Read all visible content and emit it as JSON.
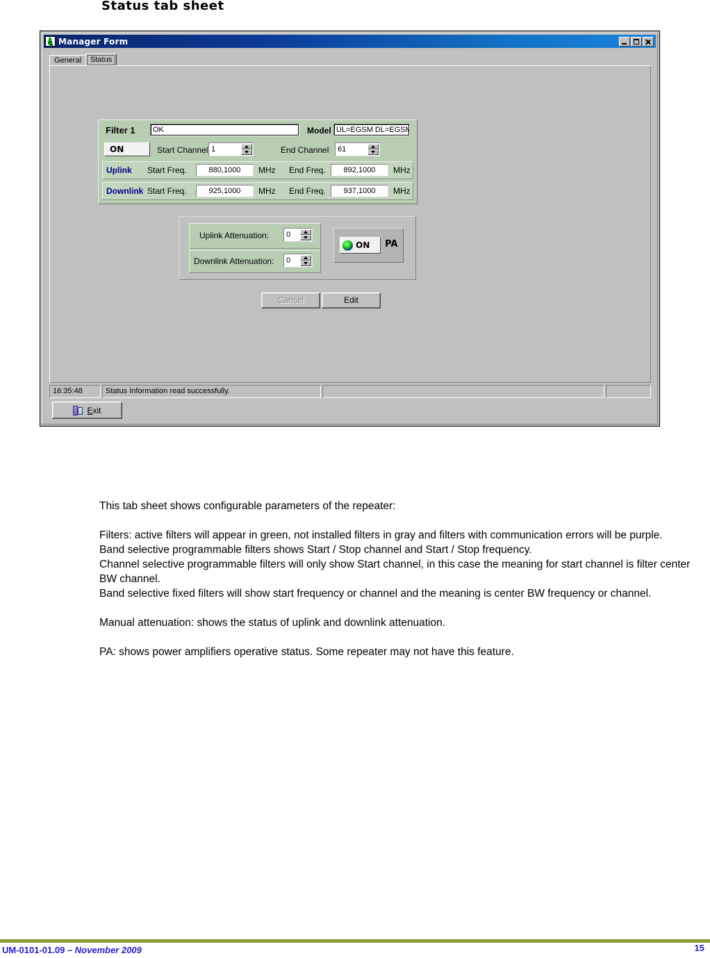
{
  "document": {
    "heading": "Status tab sheet",
    "paragraphs": [
      "This tab sheet shows configurable parameters of the repeater:",
      "Filters: active filters will appear in green, not installed filters in gray and filters with communication errors will be purple.",
      "Band selective programmable filters shows Start / Stop channel and Start / Stop frequency.",
      "Channel selective programmable filters will only show Start channel, in this case the meaning for start channel is filter center BW channel.",
      "Band selective fixed filters will show start frequency or channel and the meaning is center BW frequency or channel.",
      "Manual attenuation: shows the status of uplink and downlink attenuation.",
      "PA: shows power amplifiers operative status. Some repeater may not have this feature."
    ],
    "footer": {
      "doc_id": "UM-0101-01.09 – ",
      "date": "November 2009",
      "page_number": "15",
      "rule_color": "#8a9a32",
      "text_color": "#2222cc"
    }
  },
  "window": {
    "title": "Manager Form",
    "icon": "plug-icon",
    "titlebar_gradient_from": "#0a246a",
    "titlebar_gradient_to": "#1a84dd",
    "controls": {
      "minimize": "minimize-icon",
      "maximize": "maximize-icon",
      "close": "close-icon"
    },
    "tabs": [
      {
        "label": "General",
        "active": false
      },
      {
        "label": "Status",
        "active": true
      }
    ]
  },
  "filter_panel": {
    "background_color": "#b8ceb2",
    "title": "Filter 1",
    "state_value": "OK",
    "model_label": "Model",
    "model_value": "UL=EGSM  DL=EGSM",
    "power_state": "ON",
    "start_channel_label": "Start Channel",
    "start_channel_value": "1",
    "end_channel_label": "End Channel",
    "end_channel_value": "61",
    "uplink": {
      "name": "Uplink",
      "start_label": "Start Freq.",
      "start_value": "880,1000",
      "start_unit": "MHz",
      "end_label": "End Freq.",
      "end_value": "892,1000",
      "end_unit": "MHz"
    },
    "downlink": {
      "name": "Downlink",
      "start_label": "Start Freq.",
      "start_value": "925,1000",
      "start_unit": "MHz",
      "end_label": "End Freq.",
      "end_value": "937,1000",
      "end_unit": "MHz"
    }
  },
  "attenuation_panel": {
    "uplink_label": "Uplink Attenuation:",
    "uplink_value": "0",
    "downlink_label": "Downlink Attenuation:",
    "downlink_value": "0",
    "pa": {
      "state": "ON",
      "label": "PA",
      "led_color": "#22dd22"
    }
  },
  "actions": {
    "cancel_label": "Cancel",
    "cancel_disabled": true,
    "edit_label": "Edit"
  },
  "statusbar": {
    "time": "16:35:48",
    "message": "Status Information read successfully.",
    "panel3": "",
    "panel4": ""
  },
  "exit_button": {
    "label_accel": "E",
    "label_rest": "xit",
    "icon": "door-exit-icon"
  }
}
